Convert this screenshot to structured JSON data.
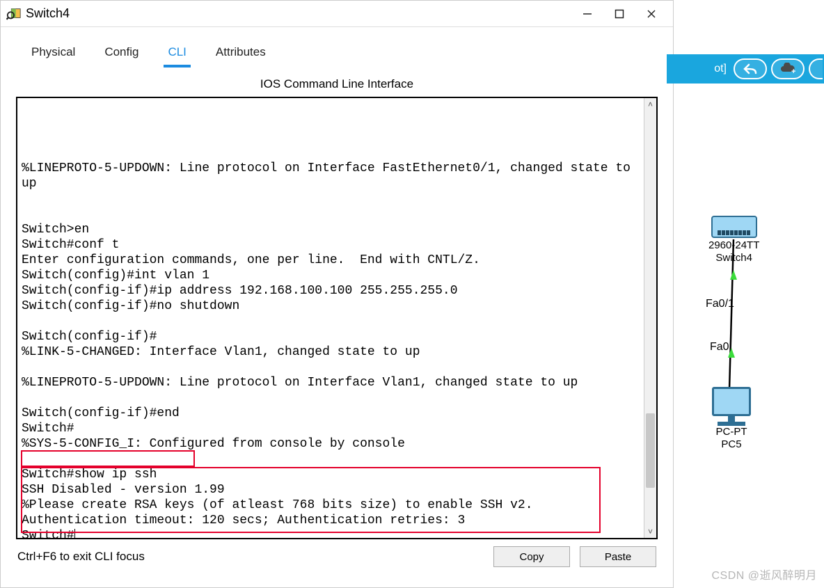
{
  "window": {
    "title": "Switch4",
    "min_tooltip": "Minimize",
    "max_tooltip": "Maximize",
    "close_tooltip": "Close"
  },
  "tabs": {
    "physical": "Physical",
    "config": "Config",
    "cli": "CLI",
    "attributes": "Attributes",
    "active": "cli"
  },
  "cli_title": "IOS Command Line Interface",
  "terminal_lines": [
    "%LINEPROTO-5-UPDOWN: Line protocol on Interface FastEthernet0/1, changed state to up",
    "",
    "",
    "Switch>en",
    "Switch#conf t",
    "Enter configuration commands, one per line.  End with CNTL/Z.",
    "Switch(config)#int vlan 1",
    "Switch(config-if)#ip address 192.168.100.100 255.255.255.0",
    "Switch(config-if)#no shutdown",
    "",
    "Switch(config-if)#",
    "%LINK-5-CHANGED: Interface Vlan1, changed state to up",
    "",
    "%LINEPROTO-5-UPDOWN: Line protocol on Interface Vlan1, changed state to up",
    "",
    "Switch(config-if)#end",
    "Switch#",
    "%SYS-5-CONFIG_I: Configured from console by console",
    "",
    "Switch#show ip ssh",
    "SSH Disabled - version 1.99",
    "%Please create RSA keys (of atleast 768 bits size) to enable SSH v2.",
    "Authentication timeout: 120 secs; Authentication retries: 3",
    "Switch#"
  ],
  "bottom": {
    "hint": "Ctrl+F6 to exit CLI focus",
    "copy": "Copy",
    "paste": "Paste"
  },
  "toolbar": {
    "remnant": "ot]"
  },
  "topology": {
    "switch_model": "2960-24TT",
    "switch_name": "Switch4",
    "port_top": "Fa0/1",
    "port_bottom": "Fa0",
    "pc_model": "PC-PT",
    "pc_name": "PC5"
  },
  "watermark": "CSDN @逝风醉明月"
}
